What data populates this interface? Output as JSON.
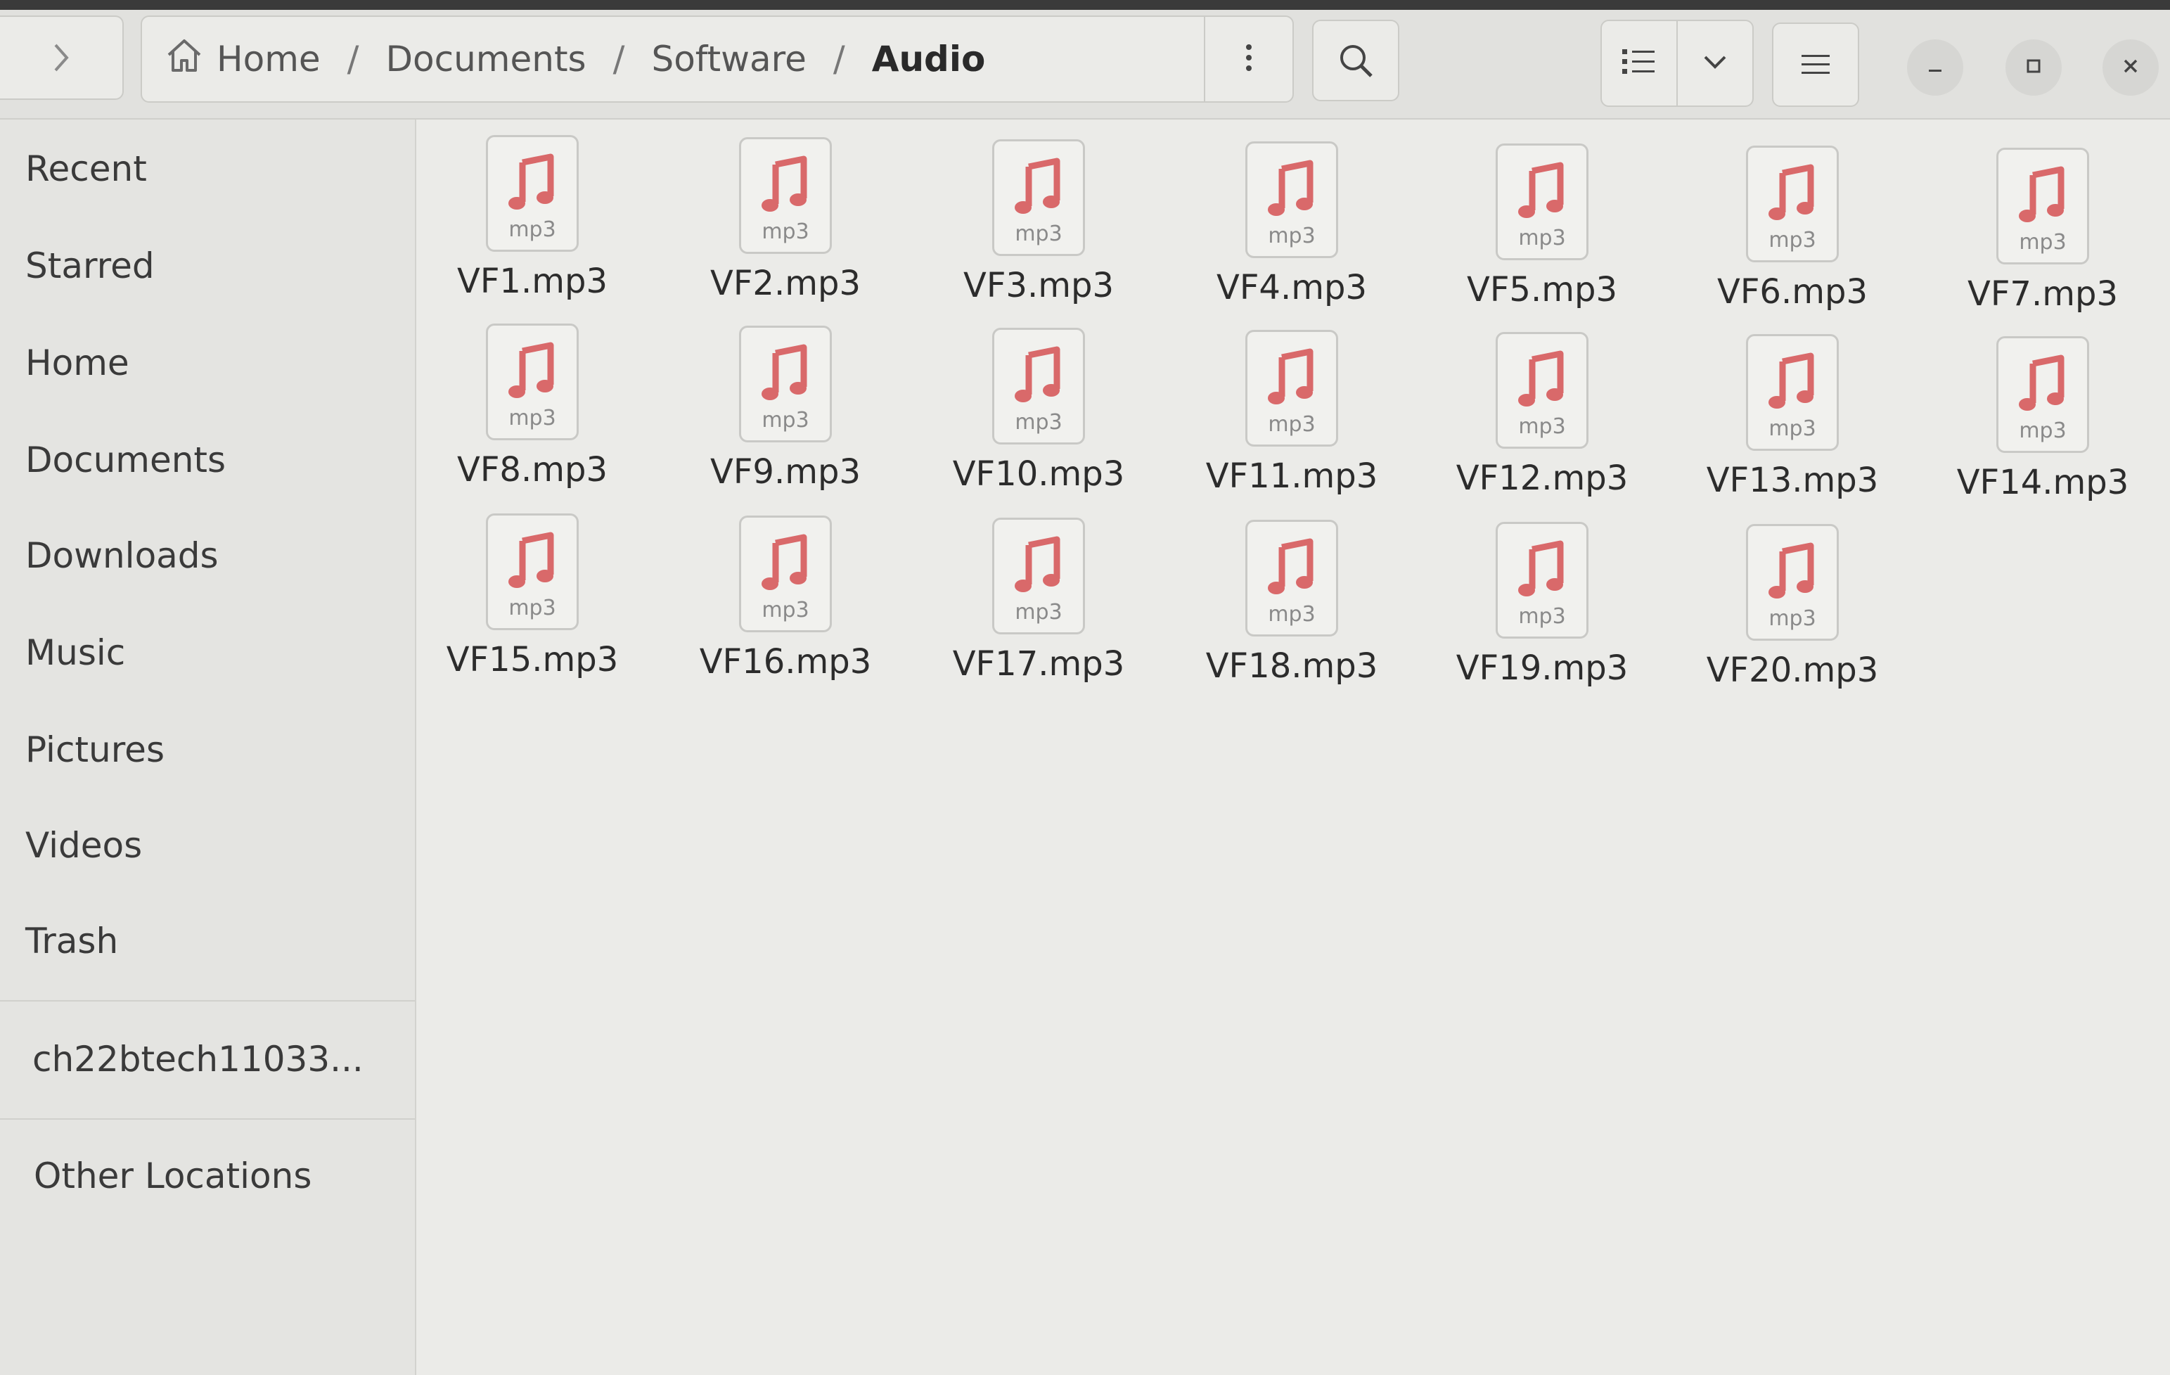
{
  "breadcrumb": {
    "items": [
      "Home",
      "Documents",
      "Software",
      "Audio"
    ],
    "separator": "/"
  },
  "icons": {
    "forward": "chevron-right-icon",
    "home": "home-icon",
    "path_menu": "vertical-dots-icon",
    "search": "search-icon",
    "list_view": "list-view-icon",
    "view_options": "chevron-down-icon",
    "main_menu": "hamburger-icon",
    "minimize": "minimize-icon",
    "maximize": "maximize-icon",
    "close": "close-icon",
    "file": "music-note-icon"
  },
  "sidebar": {
    "items": [
      {
        "label": "Recent"
      },
      {
        "label": "Starred"
      },
      {
        "label": "Home"
      },
      {
        "label": "Documents"
      },
      {
        "label": "Downloads"
      },
      {
        "label": "Music"
      },
      {
        "label": "Pictures"
      },
      {
        "label": "Videos"
      },
      {
        "label": "Trash"
      }
    ],
    "drive": {
      "label": "ch22btech11033..."
    },
    "other": {
      "label": "Other Locations"
    }
  },
  "files": [
    {
      "name": "VF1.mp3",
      "ext": "mp3"
    },
    {
      "name": "VF2.mp3",
      "ext": "mp3"
    },
    {
      "name": "VF3.mp3",
      "ext": "mp3"
    },
    {
      "name": "VF4.mp3",
      "ext": "mp3"
    },
    {
      "name": "VF5.mp3",
      "ext": "mp3"
    },
    {
      "name": "VF6.mp3",
      "ext": "mp3"
    },
    {
      "name": "VF7.mp3",
      "ext": "mp3"
    },
    {
      "name": "VF8.mp3",
      "ext": "mp3"
    },
    {
      "name": "VF9.mp3",
      "ext": "mp3"
    },
    {
      "name": "VF10.mp3",
      "ext": "mp3"
    },
    {
      "name": "VF11.mp3",
      "ext": "mp3"
    },
    {
      "name": "VF12.mp3",
      "ext": "mp3"
    },
    {
      "name": "VF13.mp3",
      "ext": "mp3"
    },
    {
      "name": "VF14.mp3",
      "ext": "mp3"
    },
    {
      "name": "VF15.mp3",
      "ext": "mp3"
    },
    {
      "name": "VF16.mp3",
      "ext": "mp3"
    },
    {
      "name": "VF17.mp3",
      "ext": "mp3"
    },
    {
      "name": "VF18.mp3",
      "ext": "mp3"
    },
    {
      "name": "VF19.mp3",
      "ext": "mp3"
    },
    {
      "name": "VF20.mp3",
      "ext": "mp3"
    }
  ],
  "colors": {
    "accent_note": "#d9696a",
    "window_bg": "#ebebe8",
    "sidebar_bg": "#e4e4e1"
  }
}
